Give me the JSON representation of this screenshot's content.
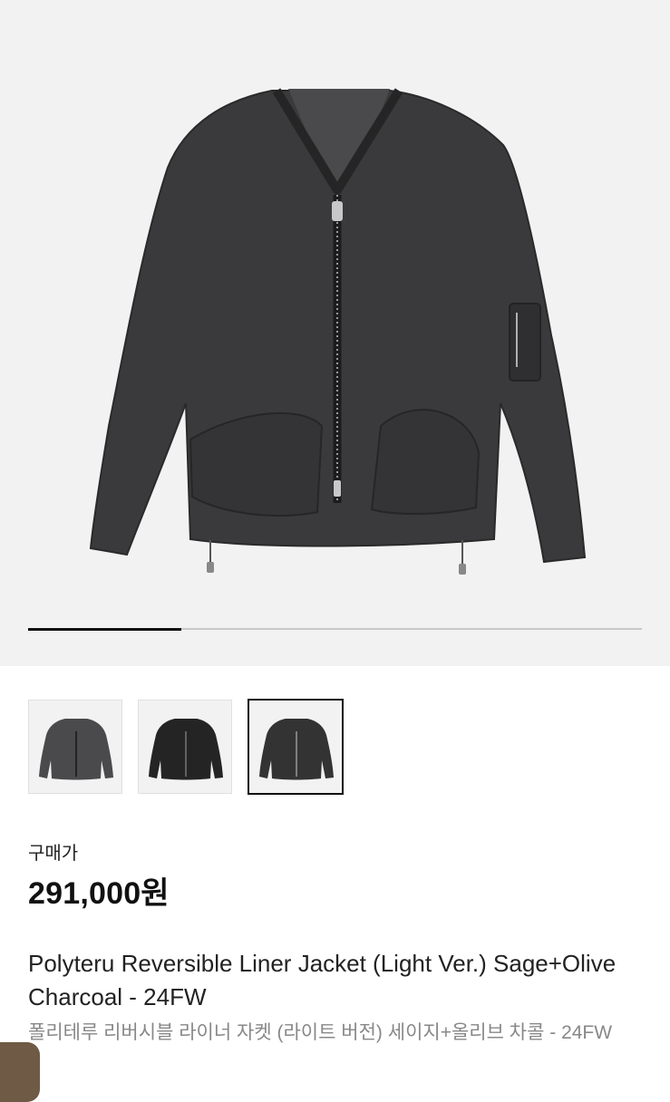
{
  "gallery": {
    "image_alt": "Polyteru Reversible Liner Jacket charcoal",
    "progress_fraction": 0.25,
    "thumbnails": [
      {
        "index": 1,
        "selected": false,
        "color": "#4a4a4c"
      },
      {
        "index": 2,
        "selected": false,
        "color": "#242424"
      },
      {
        "index": 3,
        "selected": true,
        "color": "#333334"
      }
    ]
  },
  "price": {
    "label": "구매가",
    "value": "291,000원"
  },
  "product": {
    "title_en": "Polyteru Reversible Liner Jacket (Light Ver.) Sage+Olive Charcoal - 24FW",
    "title_ko": "폴리테루 리버시블 라이너 자켓 (라이트 버전) 세이지+올리브 차콜 - 24FW"
  },
  "colors": {
    "background": "#f2f2f2",
    "jacket": "#3a3a3c",
    "progress": "#111111",
    "badge": "#6f5a45"
  }
}
